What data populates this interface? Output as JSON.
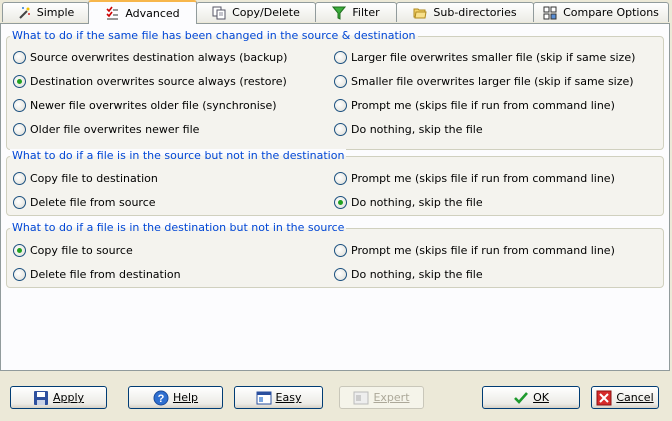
{
  "tabs": [
    {
      "label": "Simple",
      "icon": "wand-icon",
      "active": false
    },
    {
      "label": "Advanced",
      "icon": "checklist-icon",
      "active": true
    },
    {
      "label": "Copy/Delete",
      "icon": "copy-icon",
      "active": false
    },
    {
      "label": "Filter",
      "icon": "filter-icon",
      "active": false
    },
    {
      "label": "Sub-directories",
      "icon": "folders-icon",
      "active": false
    },
    {
      "label": "Compare Options",
      "icon": "compare-icon",
      "active": false
    }
  ],
  "group1": {
    "title": "What to do if the same file has been changed in the source & destination",
    "options": [
      {
        "label": "Source overwrites destination always (backup)",
        "checked": false
      },
      {
        "label": "Larger file overwrites smaller file (skip if same size)",
        "checked": false
      },
      {
        "label": "Destination overwrites source always (restore)",
        "checked": true
      },
      {
        "label": "Smaller file overwrites larger file (skip if same size)",
        "checked": false
      },
      {
        "label": "Newer file overwrites older file (synchronise)",
        "checked": false
      },
      {
        "label": "Prompt me (skips file if run from command line)",
        "checked": false
      },
      {
        "label": "Older file overwrites newer file",
        "checked": false
      },
      {
        "label": "Do nothing, skip the file",
        "checked": false
      }
    ]
  },
  "group2": {
    "title": "What to do if a file is in the source but not in the destination",
    "options": [
      {
        "label": "Copy file to destination",
        "checked": false
      },
      {
        "label": "Prompt me  (skips file if run from command line)",
        "checked": false
      },
      {
        "label": "Delete file from source",
        "checked": false
      },
      {
        "label": "Do nothing, skip the file",
        "checked": true
      }
    ]
  },
  "group3": {
    "title": "What to do if a file is in the destination but not in the source",
    "options": [
      {
        "label": "Copy file to source",
        "checked": true
      },
      {
        "label": "Prompt me  (skips file if run from command line)",
        "checked": false
      },
      {
        "label": "Delete file from destination",
        "checked": false
      },
      {
        "label": "Do nothing, skip the file",
        "checked": false
      }
    ]
  },
  "buttons": {
    "apply": "Apply",
    "help": "Help",
    "easy": "Easy",
    "expert": "Expert",
    "ok": "OK",
    "cancel": "Cancel"
  },
  "colors": {
    "accent_tab": "#f7b64b",
    "legend_text": "#0046d5",
    "radio_dot": "#21a121"
  }
}
